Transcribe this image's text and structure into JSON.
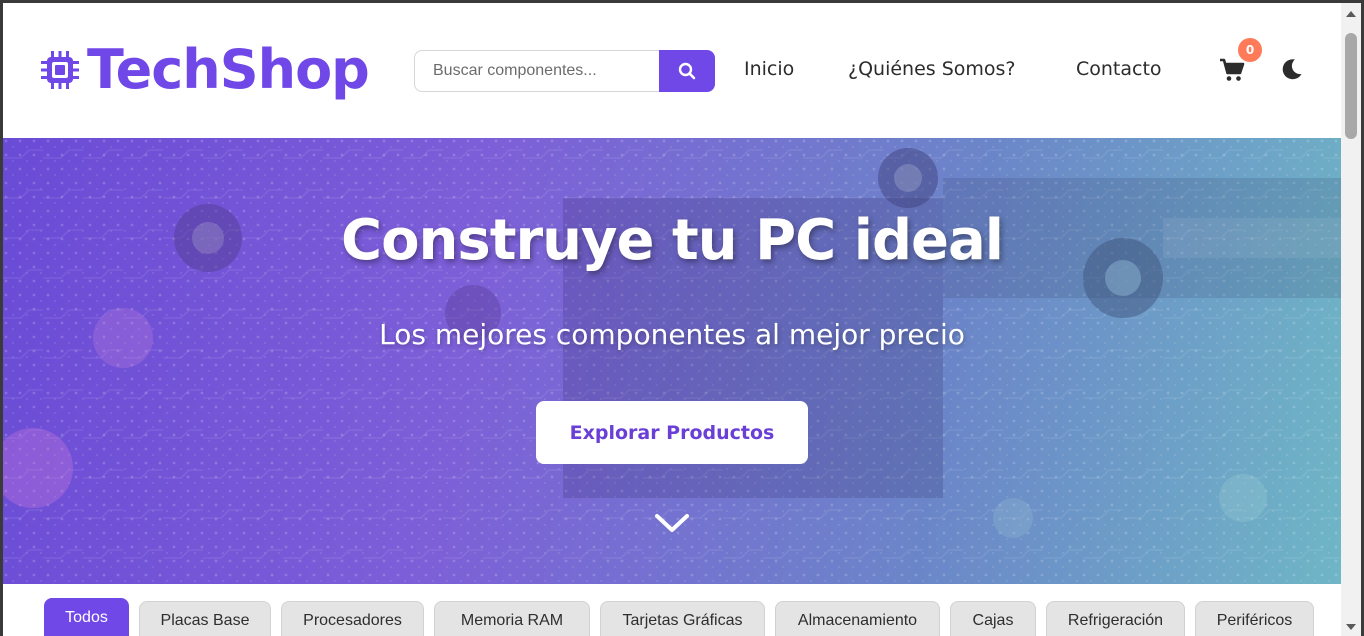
{
  "brand": {
    "name": "TechShop",
    "icon": "cpu-chip-icon",
    "color": "#7048e8"
  },
  "search": {
    "placeholder": "Buscar componentes...",
    "value": "",
    "button_icon": "search-icon"
  },
  "nav": {
    "items": [
      {
        "label": "Inicio"
      },
      {
        "label": "¿Quiénes Somos?"
      },
      {
        "label": "Contacto"
      }
    ]
  },
  "cart": {
    "icon": "shopping-cart-icon",
    "count": "0",
    "badge_color": "#ff7a59"
  },
  "theme_toggle": {
    "icon": "moon-icon"
  },
  "hero": {
    "title": "Construye tu PC ideal",
    "subtitle": "Los mejores componentes al mejor precio",
    "cta_label": "Explorar Productos",
    "scroll_icon": "chevron-down-icon"
  },
  "categories": {
    "active": "Todos",
    "items": [
      {
        "label": "Todos"
      },
      {
        "label": "Placas Base"
      },
      {
        "label": "Procesadores"
      },
      {
        "label": "Memoria RAM"
      },
      {
        "label": "Tarjetas Gráficas"
      },
      {
        "label": "Almacenamiento"
      },
      {
        "label": "Cajas"
      },
      {
        "label": "Refrigeración"
      },
      {
        "label": "Periféricos"
      }
    ]
  }
}
